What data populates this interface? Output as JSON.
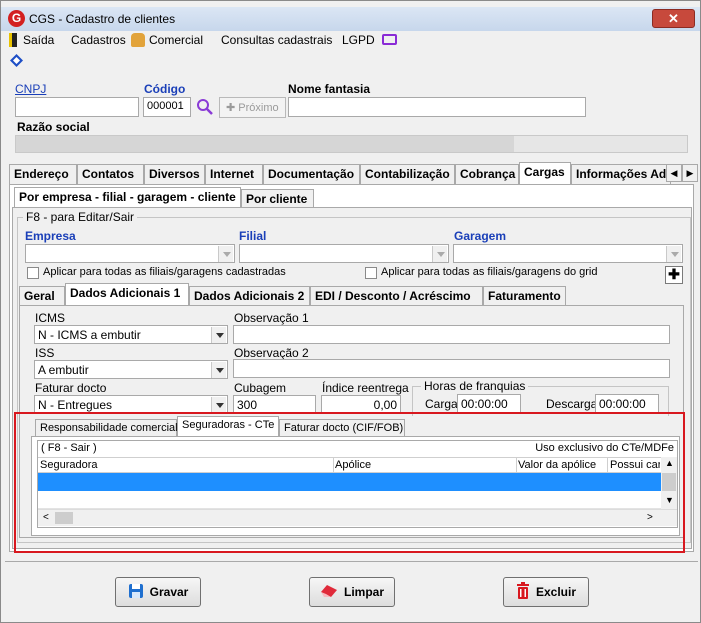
{
  "window": {
    "title": "CGS - Cadastro de clientes",
    "close_glyph": "✕",
    "app_logo": "G"
  },
  "menu": [
    {
      "label": "Saída",
      "icon": "exit-door-icon"
    },
    {
      "label": "Cadastros"
    },
    {
      "label": "Comercial",
      "icon": "people-icon"
    },
    {
      "label": "Consultas cadastrais"
    },
    {
      "label": "LGPD",
      "icon": "monitor-icon"
    }
  ],
  "header": {
    "cnpj_label": "CNPJ",
    "codigo_label": "Código",
    "codigo_value": "000001",
    "proximo_label": "Próximo",
    "nome_fantasia_label": "Nome fantasia",
    "razao_social_label": "Razão social"
  },
  "main_tabs": [
    "Endereço",
    "Contatos",
    "Diversos",
    "Internet",
    "Documentação",
    "Contabilização",
    "Cobrança",
    "Cargas",
    "Informações Adi"
  ],
  "sub_tabs": [
    "Por empresa - filial - garagem - cliente",
    "Por cliente"
  ],
  "edit_group": {
    "title": "F8 - para Editar/Sair",
    "empresa_label": "Empresa",
    "filial_label": "Filial",
    "garagem_label": "Garagem",
    "aplicar_filiais": "Aplicar para todas as filiais/garagens cadastradas",
    "aplicar_grid": "Aplicar para todas as filiais/garagens do grid"
  },
  "detail_tabs": [
    "Geral",
    "Dados Adicionais 1",
    "Dados Adicionais 2",
    "EDI / Desconto / Acréscimo",
    "Faturamento"
  ],
  "dados_adicionais": {
    "icms_label": "ICMS",
    "icms_value": "N - ICMS a embutir",
    "obs1_label": "Observação 1",
    "iss_label": "ISS",
    "iss_value": "A embutir",
    "obs2_label": "Observação 2",
    "faturar_label": "Faturar docto",
    "faturar_value": "N - Entregues",
    "cubagem_label": "Cubagem",
    "cubagem_value": "300",
    "indice_label": "Índice reentrega",
    "indice_value": "0,00",
    "horas_label": "Horas de franquias",
    "carga_label": "Carga",
    "carga_value": "00:00:00",
    "descarga_label": "Descarga",
    "descarga_value": "00:00:00"
  },
  "inner_tabs": [
    "Responsabilidade comercial",
    "Seguradoras - CTe",
    "Faturar docto (CIF/FOB)"
  ],
  "seguradoras_grid": {
    "f8_hint": "( F8 - Sair )",
    "exclusive_note": "Uso exclusivo do CTe/MDFe",
    "columns": [
      "Seguradora",
      "Apólice",
      "Valor da apólice",
      "Possui car"
    ]
  },
  "footer_buttons": {
    "gravar": "Gravar",
    "limpar": "Limpar",
    "excluir": "Excluir"
  },
  "colors": {
    "selection": "#1e8fff",
    "highlight_box": "#d8181f"
  }
}
